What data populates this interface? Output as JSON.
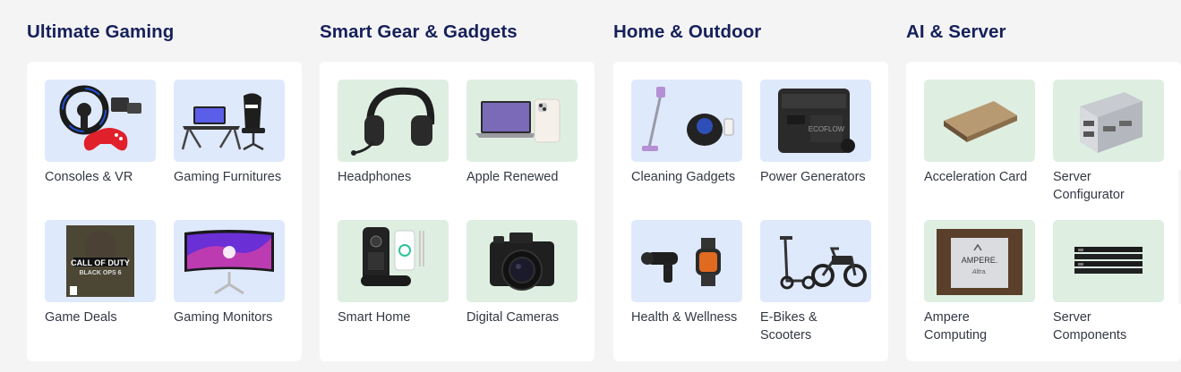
{
  "sections": [
    {
      "title": "Ultimate Gaming",
      "tiles": [
        {
          "label": "Consoles & VR",
          "icon": "racing-wheel-controller-icon"
        },
        {
          "label": "Gaming Furnitures",
          "icon": "gaming-desk-chair-icon"
        },
        {
          "label": "Game Deals",
          "icon": "game-box-icon"
        },
        {
          "label": "Gaming Monitors",
          "icon": "curved-monitor-icon"
        }
      ]
    },
    {
      "title": "Smart Gear & Gadgets",
      "tiles": [
        {
          "label": "Headphones",
          "icon": "headset-icon"
        },
        {
          "label": "Apple Renewed",
          "icon": "laptop-phone-icon"
        },
        {
          "label": "Smart Home",
          "icon": "smart-lock-icon"
        },
        {
          "label": "Digital Cameras",
          "icon": "camera-icon"
        }
      ]
    },
    {
      "title": "Home & Outdoor",
      "tiles": [
        {
          "label": "Cleaning Gadgets",
          "icon": "vacuum-robot-icon"
        },
        {
          "label": "Power Generators",
          "icon": "power-station-icon"
        },
        {
          "label": "Health & Wellness",
          "icon": "massage-gun-watch-icon"
        },
        {
          "label": "E-Bikes & Scooters",
          "icon": "scooter-bike-icon"
        }
      ]
    },
    {
      "title": "AI & Server",
      "tiles": [
        {
          "label": "Acceleration Card",
          "icon": "gpu-card-icon"
        },
        {
          "label": "Server Configurator",
          "icon": "server-rack-icon"
        },
        {
          "label": "Ampere Computing",
          "icon": "ampere-chip-icon",
          "chip_text": "AMPERE.",
          "chip_subtext": "Altra."
        },
        {
          "label": "Server Components",
          "icon": "memory-modules-icon"
        }
      ]
    }
  ],
  "colors": {
    "title": "#16205a",
    "tile_blue": "#dfe9fc",
    "tile_green": "#deefe2",
    "page_bg": "#f4f4f5"
  }
}
